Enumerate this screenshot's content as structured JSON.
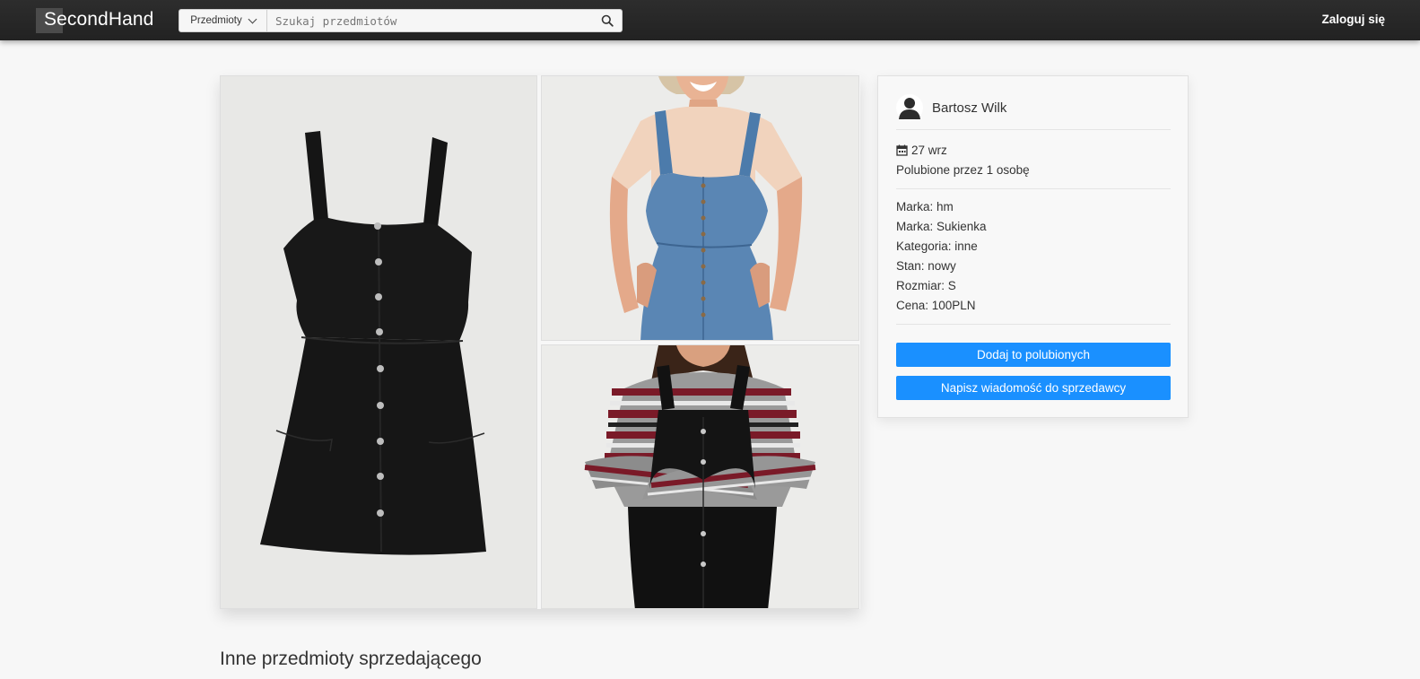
{
  "navbar": {
    "logo_text": "SecondHand",
    "category_select": "Przedmioty",
    "search_placeholder": "Szukaj przedmiotów",
    "login_label": "Zaloguj się"
  },
  "seller": {
    "name": "Bartosz Wilk",
    "date": "27 wrz",
    "likes": "Polubione przez 1 osobę"
  },
  "details": [
    "Marka: hm",
    "Marka: Sukienka",
    "Kategoria: inne",
    "Stan: nowy",
    "Rozmiar: S",
    "Cena: 100PLN"
  ],
  "actions": {
    "like_label": "Dodaj to polubionych",
    "message_label": "Napisz wiadomość do sprzedawcy"
  },
  "sections": {
    "other_items_title": "Inne przedmioty sprzedającego"
  },
  "colors": {
    "navbar": "#222222",
    "accent": "#1a90ff",
    "background": "#f7f7f7"
  },
  "icons": {
    "search": "magnifier",
    "avatar": "user-silhouette",
    "date": "calendar"
  }
}
